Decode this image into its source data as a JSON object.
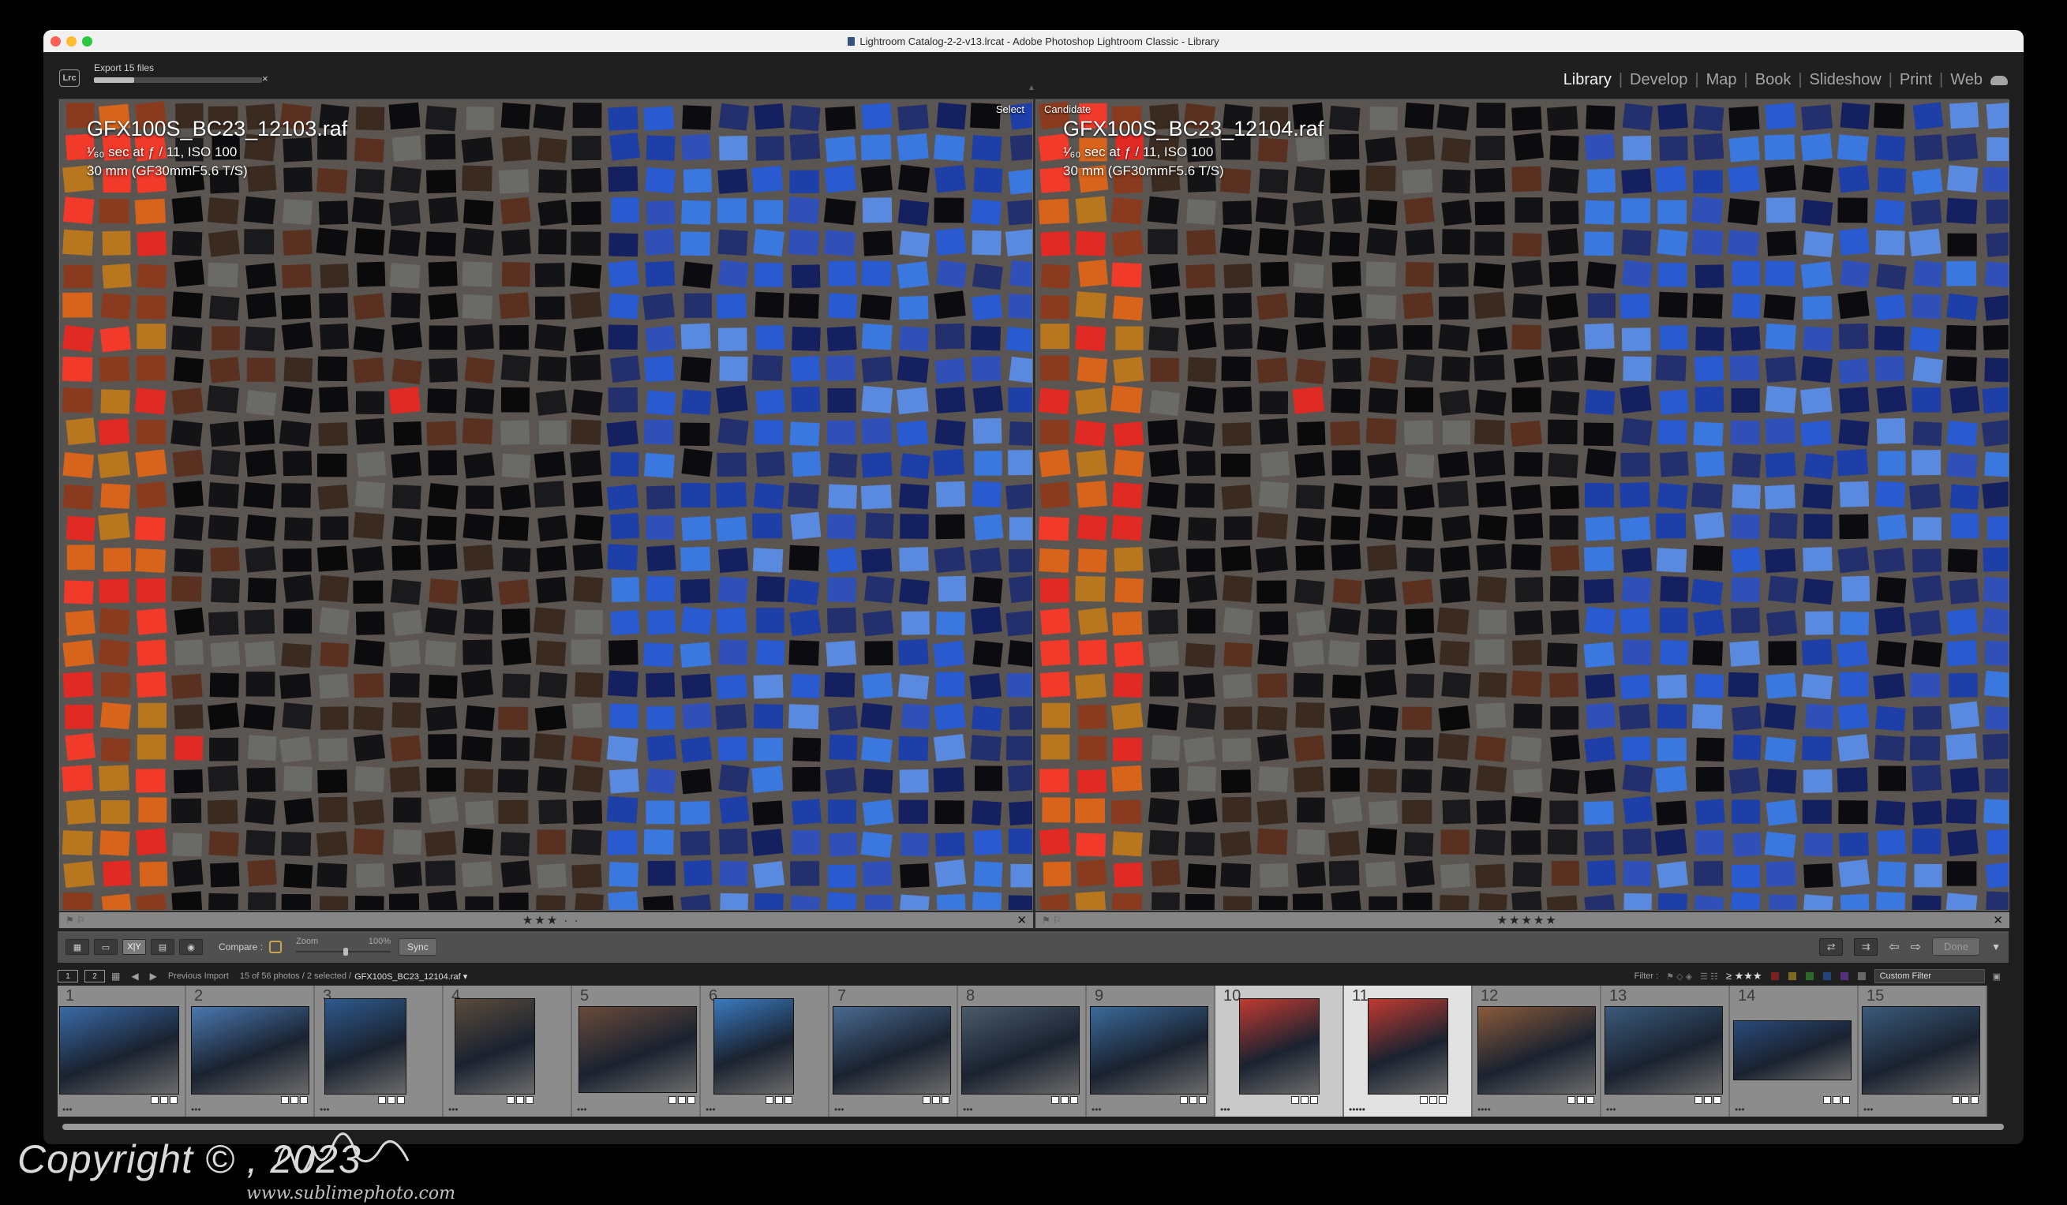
{
  "window": {
    "title": "Lightroom Catalog-2-2-v13.lrcat - Adobe Photoshop Lightroom Classic - Library"
  },
  "topbar": {
    "logo": "Lrc",
    "export_label": "Export 15 files",
    "export_progress": 0.24,
    "export_cancel": "×",
    "modules": [
      "Library",
      "Develop",
      "Map",
      "Book",
      "Slideshow",
      "Print",
      "Web"
    ],
    "active_module": "Library"
  },
  "compare": {
    "select": {
      "tag": "Select",
      "filename": "GFX100S_BC23_12103.raf",
      "exposure": "¹⁄₆₀ sec at ƒ / 11, ISO 100",
      "lens": "30 mm (GF30mmF5.6 T/S)",
      "rating": "★★★ · ·"
    },
    "candidate": {
      "tag": "Candidate",
      "filename": "GFX100S_BC23_12104.raf",
      "exposure": "¹⁄₆₀ sec at ƒ / 11, ISO 100",
      "lens": "30 mm (GF30mmF5.6 T/S)",
      "rating": "★★★★★"
    }
  },
  "toolbar": {
    "compare_label": "Compare :",
    "zoom_label": "Zoom",
    "zoom_value": "100%",
    "sync_label": "Sync",
    "done_label": "Done",
    "xy_label": "X|Y"
  },
  "filmstrip_bar": {
    "monitor_1": "1",
    "monitor_2": "2",
    "source": "Previous Import",
    "count": "15 of 56 photos / 2 selected /",
    "current_file": "GFX100S_BC23_12104.raf ▾",
    "filter_label": "Filter :",
    "rating_filter": "≥ ★★★",
    "custom_filter": "Custom Filter"
  },
  "filmstrip": [
    {
      "n": "1",
      "dots": "•••"
    },
    {
      "n": "2",
      "dots": "•••"
    },
    {
      "n": "3",
      "dots": "•••"
    },
    {
      "n": "4",
      "dots": "•••"
    },
    {
      "n": "5",
      "dots": "•••"
    },
    {
      "n": "6",
      "dots": "•••"
    },
    {
      "n": "7",
      "dots": "•••"
    },
    {
      "n": "8",
      "dots": "•••"
    },
    {
      "n": "9",
      "dots": "•••"
    },
    {
      "n": "10",
      "dots": "•••"
    },
    {
      "n": "11",
      "dots": "•••••"
    },
    {
      "n": "12",
      "dots": "••••"
    },
    {
      "n": "13",
      "dots": "•••"
    },
    {
      "n": "14",
      "dots": "•••"
    },
    {
      "n": "15",
      "dots": "•••"
    }
  ],
  "watermark": {
    "text": "Copyright ©            , 2023",
    "url": "www.sublimephoto.com"
  },
  "colors": {
    "panel": "#1f1f1f",
    "toolbar": "#505050",
    "accent_lock": "#c8a44a"
  }
}
